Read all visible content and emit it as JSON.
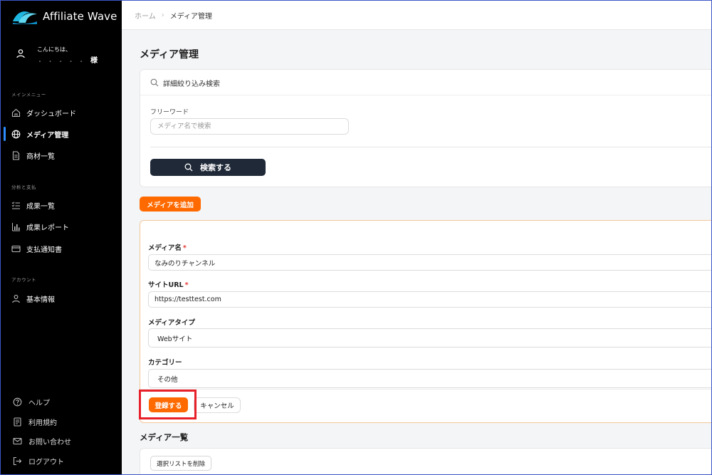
{
  "brand": {
    "name": "Affiliate Wave",
    "logo_icon": "wave-logo-icon"
  },
  "user": {
    "greeting": "こんにちは、",
    "name_masked": "・ ・ ・ ・ ・",
    "honorific": "様",
    "icon": "user-icon"
  },
  "sidebar": {
    "sections": [
      {
        "label": "メインメニュー",
        "items": [
          {
            "label": "ダッシュボード",
            "icon": "home-icon"
          },
          {
            "label": "メディア管理",
            "icon": "globe-icon",
            "active": true
          },
          {
            "label": "商材一覧",
            "icon": "document-icon"
          }
        ]
      },
      {
        "label": "分析と支払",
        "items": [
          {
            "label": "成果一覧",
            "icon": "list-check-icon"
          },
          {
            "label": "成果レポート",
            "icon": "bar-chart-icon"
          },
          {
            "label": "支払通知書",
            "icon": "card-icon"
          }
        ]
      },
      {
        "label": "アカウント",
        "items": [
          {
            "label": "基本情報",
            "icon": "user-icon"
          }
        ]
      }
    ],
    "footer": [
      {
        "label": "ヘルプ",
        "icon": "help-icon"
      },
      {
        "label": "利用規約",
        "icon": "terms-icon"
      },
      {
        "label": "お問い合わせ",
        "icon": "mail-icon"
      },
      {
        "label": "ログアウト",
        "icon": "logout-icon"
      }
    ]
  },
  "breadcrumb": {
    "home": "ホーム",
    "separator": "›",
    "current": "メディア管理"
  },
  "page": {
    "title": "メディア管理"
  },
  "search": {
    "title": "詳細絞り込み検索",
    "free_word_label": "フリーワード",
    "free_word_placeholder": "メディア名で検索",
    "free_word_value": "",
    "button_label": "検索する"
  },
  "add_button_label": "メディアを追加",
  "form": {
    "media_name": {
      "label": "メディア名",
      "required_mark": "*",
      "value": "なみのりチャンネル"
    },
    "site_url": {
      "label": "サイトURL",
      "required_mark": "*",
      "value": "https://testtest.com"
    },
    "media_type": {
      "label": "メディアタイプ",
      "value": "Webサイト"
    },
    "category": {
      "label": "カテゴリー",
      "value": "その他"
    },
    "submit_label": "登録する",
    "cancel_label": "キャンセル"
  },
  "list": {
    "title": "メディア一覧",
    "delete_button_label": "選択リストを削除"
  },
  "colors": {
    "sidebar_bg": "#000000",
    "accent_orange": "#ff6a00",
    "dark_button": "#1f2937",
    "active_indicator": "#2f8cff",
    "highlight_box": "#e8202a"
  }
}
